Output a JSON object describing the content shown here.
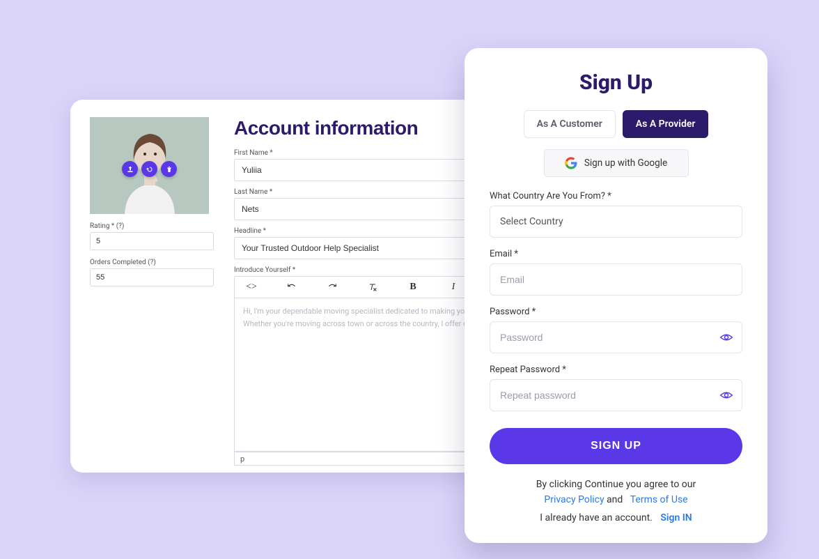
{
  "account": {
    "title": "Account information",
    "avatar_buttons": {
      "upload": "upload",
      "rotate": "rotate",
      "delete": "delete"
    },
    "rating": {
      "label": "Rating * (?)",
      "value": "5"
    },
    "orders": {
      "label": "Orders Completed (?)",
      "value": "55"
    },
    "first_name": {
      "label": "First Name *",
      "value": "Yuliia"
    },
    "last_name": {
      "label": "Last Name *",
      "value": "Nets"
    },
    "headline": {
      "label": "Headline *",
      "value": "Your Trusted Outdoor Help Specialist"
    },
    "introduce": {
      "label": "Introduce Yourself *",
      "placeholder": "Hi, I'm your dependable moving specialist dedicated to making your relocation a seamless and stress-free experience. Whether you're moving across town or across the country, I offer comprehensive...",
      "footer": "p"
    },
    "toolbar": {
      "code": "<>",
      "undo": "undo",
      "redo": "redo",
      "clear": "clear-format",
      "bold": "B",
      "italic": "I"
    }
  },
  "signup": {
    "title": "Sign Up",
    "tabs": {
      "customer": "As A Customer",
      "provider": "As A Provider"
    },
    "google_label": "Sign up with Google",
    "country": {
      "label": "What Country Are You From? *",
      "placeholder": "Select Country"
    },
    "email": {
      "label": "Email *",
      "placeholder": "Email"
    },
    "password": {
      "label": "Password *",
      "placeholder": "Password"
    },
    "repeat": {
      "label": "Repeat Password *",
      "placeholder": "Repeat password"
    },
    "submit": "SIGN UP",
    "agree_pre": "By clicking Continue you agree to our",
    "privacy": "Privacy Policy",
    "and": " and ",
    "terms": "Terms of Use",
    "have_account": "I already have an account.",
    "signin": "Sign IN"
  }
}
